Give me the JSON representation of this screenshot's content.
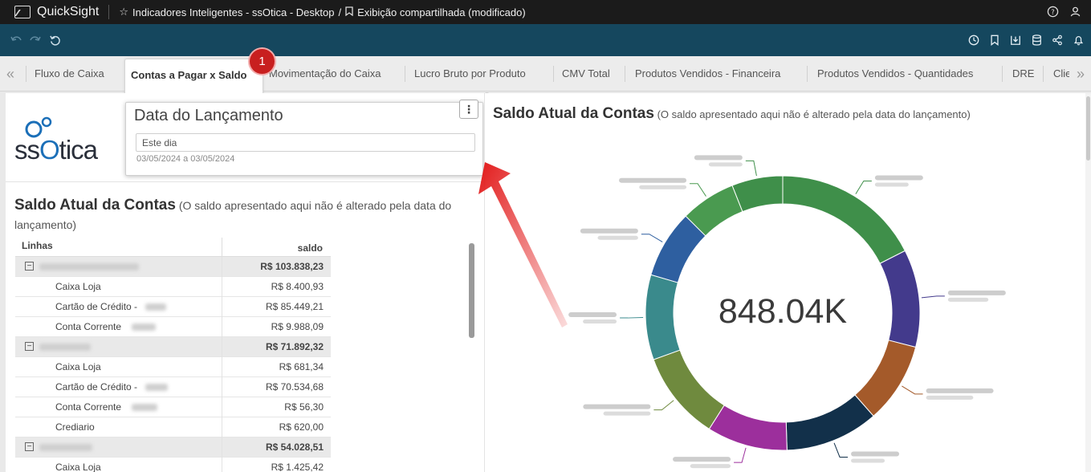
{
  "app": {
    "name": "QuickSight",
    "breadcrumb_title": "Indicadores Inteligentes - ssOtica - Desktop",
    "breadcrumb_sep": "/",
    "breadcrumb_view": "Exibição compartilhada (modificado)"
  },
  "tabs": {
    "items": [
      "Fluxo de Caixa",
      "Movimentação do Caixa",
      "Lucro Bruto por Produto",
      "CMV Total",
      "Produtos Vendidos - Financeira",
      "Produtos Vendidos - Quantidades",
      "DRE",
      "Clie"
    ],
    "active": "Contas a Pagar x Saldo",
    "badge": "1"
  },
  "brand": {
    "logo_prefix": "ss",
    "logo_o": "O",
    "logo_suffix": "tica"
  },
  "filter": {
    "title": "Data do Lançamento",
    "value": "Este dia",
    "range": "03/05/2024 a 03/05/2024"
  },
  "left_panel": {
    "title": "Saldo Atual da Contas",
    "subtitle": "(O saldo apresentado aqui não é alterado pela data do lançamento)",
    "col_lines": "Linhas",
    "col_saldo": "saldo",
    "rows": [
      {
        "type": "group",
        "label": "",
        "value": "R$ 103.838,23"
      },
      {
        "type": "item",
        "label": "Caixa Loja",
        "value": "R$ 8.400,93"
      },
      {
        "type": "item",
        "label": "Cartão de Crédito -",
        "value": "R$ 85.449,21"
      },
      {
        "type": "item",
        "label": "Conta Corrente",
        "value": "R$ 9.988,09"
      },
      {
        "type": "group",
        "label": "",
        "value": "R$ 71.892,32"
      },
      {
        "type": "item",
        "label": "Caixa Loja",
        "value": "R$ 681,34"
      },
      {
        "type": "item",
        "label": "Cartão de Crédito -",
        "value": "R$ 70.534,68"
      },
      {
        "type": "item",
        "label": "Conta Corrente",
        "value": "R$ 56,30"
      },
      {
        "type": "item",
        "label": "Crediario",
        "value": "R$ 620,00"
      },
      {
        "type": "group",
        "label": "",
        "value": "R$ 54.028,51"
      },
      {
        "type": "item",
        "label": "Caixa Loja",
        "value": "R$ 1.425,42"
      }
    ]
  },
  "right_panel": {
    "title": "Saldo Atual da Contas",
    "subtitle": "(O saldo apresentado aqui não é alterado pela data do lançamento)",
    "center_value": "848.04K"
  },
  "chart_data": {
    "type": "pie",
    "values": [
      17.5,
      11.5,
      9.5,
      11,
      9.5,
      10.5,
      10,
      8,
      6.5,
      6
    ],
    "colors": [
      "#3f8f4a",
      "#433a8c",
      "#a45a2a",
      "#12304a",
      "#9c2f9c",
      "#6f8a3e",
      "#3a8a8c",
      "#2e5fa0",
      "#4a9a50",
      "#3f8f4a"
    ],
    "center_value": "848.04K"
  },
  "colors": {
    "topbar": "#1b1b1b",
    "toolbar": "#15475e",
    "badge": "#c81f1f",
    "arrow": "#e21b1b"
  }
}
